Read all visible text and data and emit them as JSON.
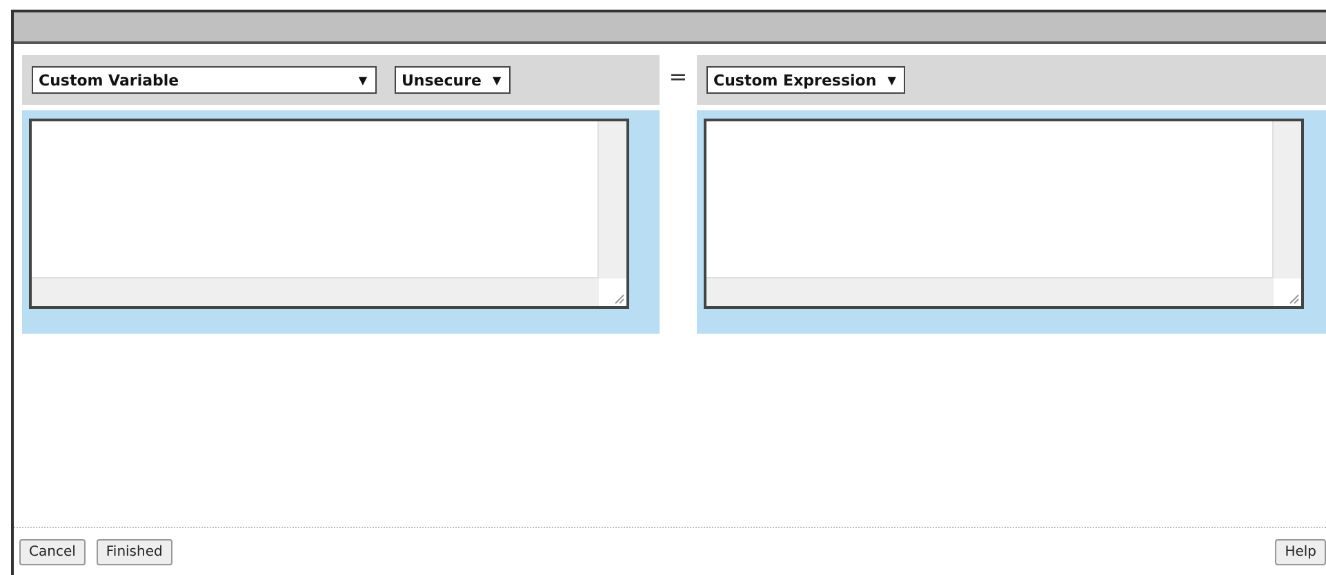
{
  "left_panel": {
    "dropdowns": [
      {
        "value": "Custom Variable",
        "arrow": "▼"
      },
      {
        "value": "Unsecure",
        "arrow": "▼"
      }
    ]
  },
  "operator": "=",
  "right_panel": {
    "dropdowns": [
      {
        "value": "Custom Expression",
        "arrow": "▼"
      }
    ]
  },
  "footer": {
    "left_buttons": [
      "Cancel",
      "Finished"
    ],
    "right_buttons": [
      "Help"
    ]
  }
}
